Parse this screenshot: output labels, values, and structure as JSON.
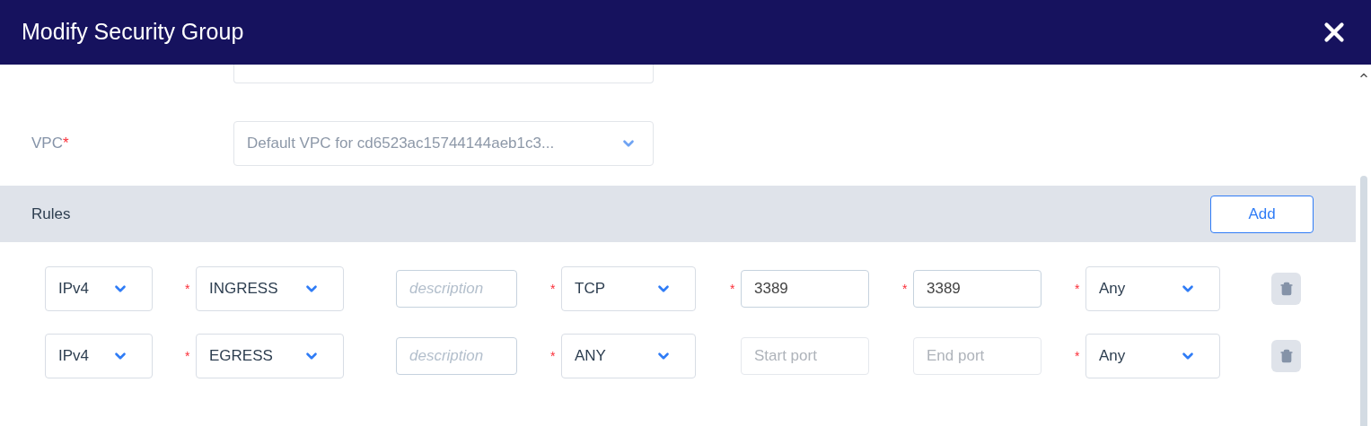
{
  "dialog": {
    "title": "Modify Security Group"
  },
  "required_mark": "*",
  "vpc_field": {
    "label": "VPC",
    "required": true,
    "disabled": true,
    "value": "Default VPC for cd6523ac15744144aeb1c3..."
  },
  "rules_section": {
    "title": "Rules",
    "add_button": "Add"
  },
  "rules": [
    {
      "ether_type": {
        "value": "IPv4",
        "required": false
      },
      "direction": {
        "value": "INGRESS",
        "required": true
      },
      "description": {
        "placeholder": "description"
      },
      "protocol": {
        "value": "TCP",
        "required": true
      },
      "start_port": {
        "value": "3389",
        "required": true,
        "disabled": false
      },
      "end_port": {
        "value": "3389",
        "required": true,
        "disabled": false
      },
      "remote": {
        "value": "Any",
        "required": true
      }
    },
    {
      "ether_type": {
        "value": "IPv4",
        "required": false
      },
      "direction": {
        "value": "EGRESS",
        "required": true
      },
      "description": {
        "placeholder": "description"
      },
      "protocol": {
        "value": "ANY",
        "required": true
      },
      "start_port": {
        "placeholder": "Start port",
        "required": false,
        "disabled": true
      },
      "end_port": {
        "placeholder": "End port",
        "required": false,
        "disabled": true
      },
      "remote": {
        "value": "Any",
        "required": true
      }
    }
  ]
}
